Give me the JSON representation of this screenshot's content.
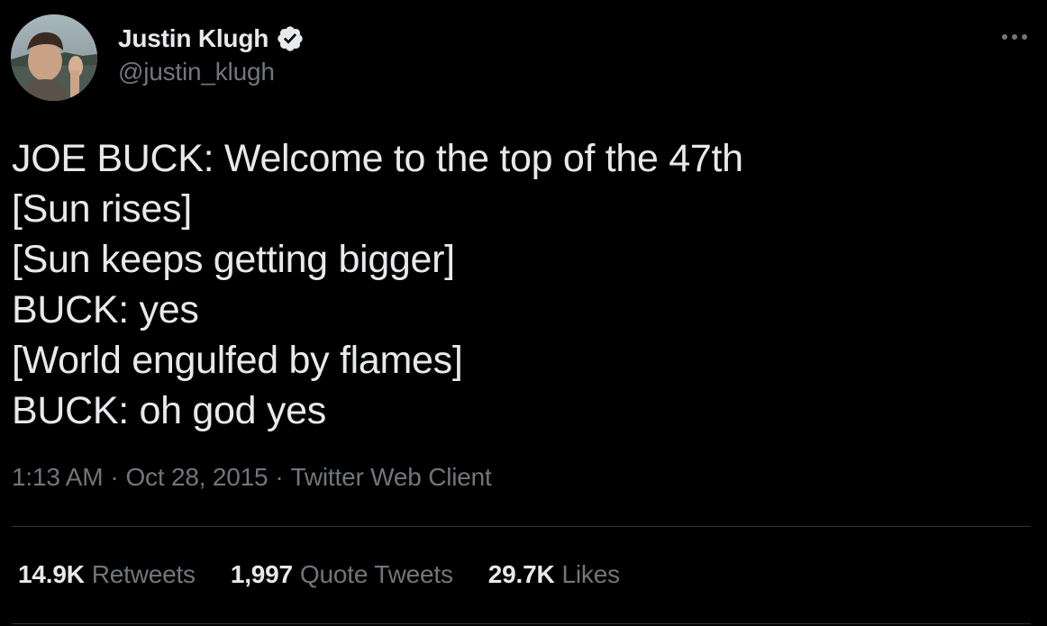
{
  "author": {
    "name": "Justin Klugh",
    "handle": "@justin_klugh",
    "verified": true
  },
  "icons": {
    "verified": "verified-badge-icon",
    "more": "more-dots-icon"
  },
  "tweet": {
    "lines": [
      "JOE BUCK: Welcome to the top of the 47th",
      "[Sun rises]",
      "[Sun keeps getting bigger]",
      "BUCK: yes",
      "[World engulfed by flames]",
      "BUCK: oh god yes"
    ],
    "time": "1:13 AM",
    "separator": "·",
    "date": "Oct 28, 2015",
    "source": "Twitter Web Client"
  },
  "stats": {
    "retweets_count": "14.9K",
    "retweets_label": "Retweets",
    "quotes_count": "1,997",
    "quotes_label": "Quote Tweets",
    "likes_count": "29.7K",
    "likes_label": "Likes"
  },
  "colors": {
    "background": "#000000",
    "primary_text": "#e7e9ea",
    "secondary_text": "#71767b",
    "divider": "#2f3336"
  }
}
